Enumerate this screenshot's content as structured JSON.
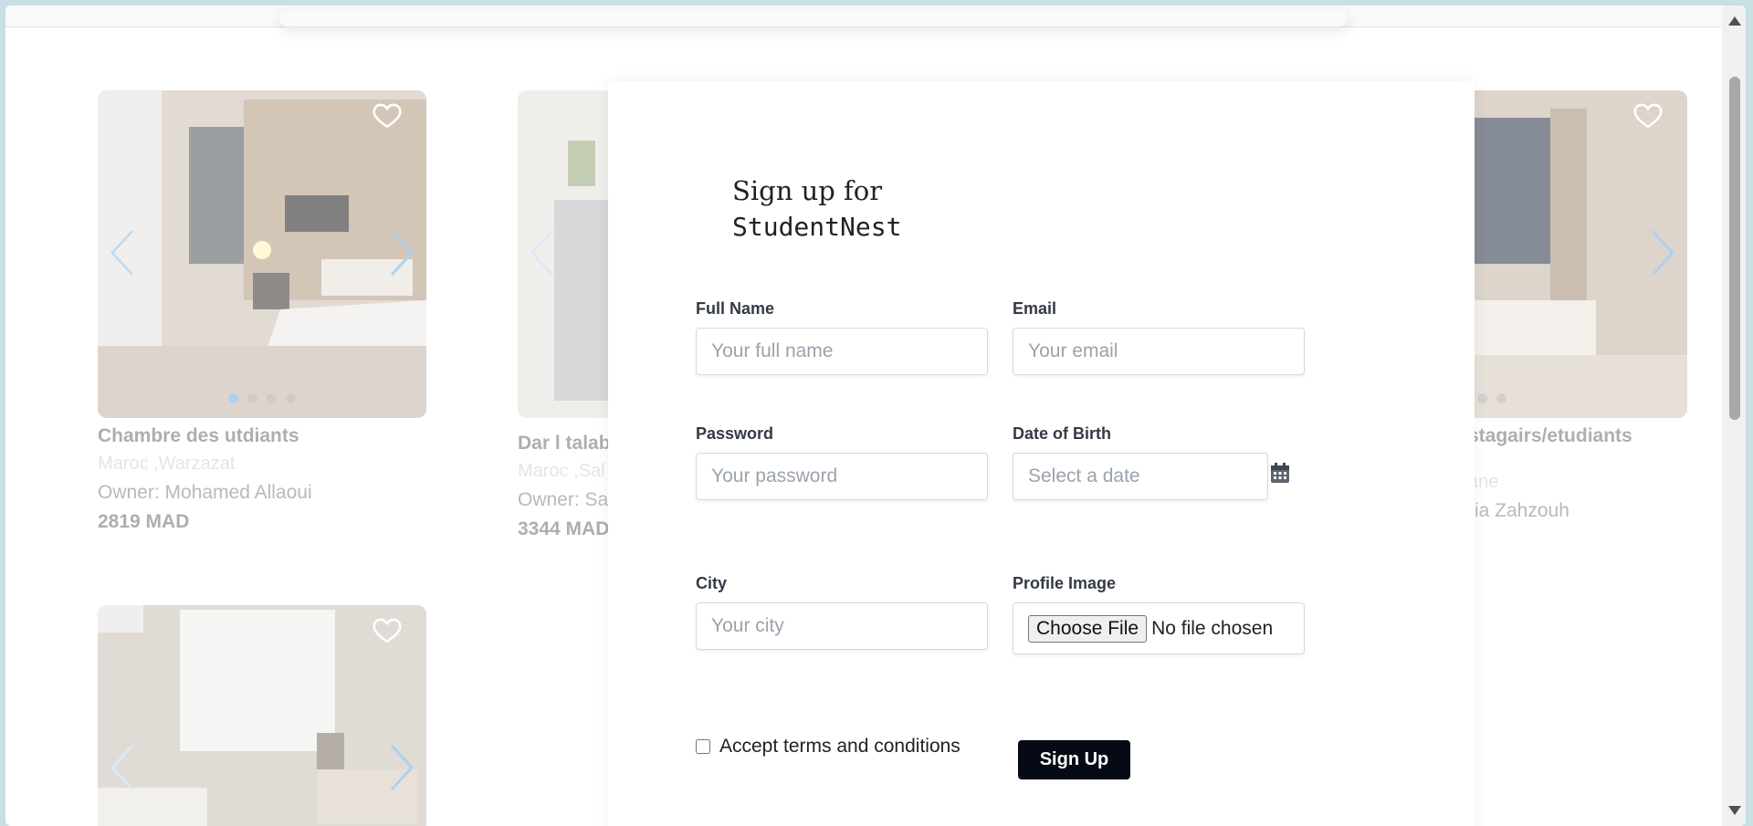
{
  "listings": [
    {
      "title": "Chambre des utdiants",
      "location": "Maroc ,Warzazat",
      "owner": "Owner: Mohamed Allaoui",
      "price": "2819 MAD",
      "dots": 4
    },
    {
      "title": "Dar l talab",
      "location": "Maroc ,Sal",
      "owner": "Owner: Saa",
      "price": "3344 MAD"
    },
    {
      "title": " stagairs/etudiants",
      "location": "ane",
      "owner": "ria Zahzouh",
      "price": "",
      "dots": 3
    },
    {
      "title": "",
      "location": "",
      "owner": "",
      "price": ""
    }
  ],
  "signup": {
    "title_line1": "Sign up for",
    "title_brand": "StudentNest",
    "full_name_label": "Full Name",
    "full_name_placeholder": "Your full name",
    "email_label": "Email",
    "email_placeholder": "Your email",
    "password_label": "Password",
    "password_placeholder": "Your password",
    "dob_label": "Date of Birth",
    "dob_placeholder": "Select a date",
    "city_label": "City",
    "city_placeholder": "Your city",
    "profile_image_label": "Profile Image",
    "file_button": "Choose File",
    "file_status": "No file chosen",
    "terms_label": "Accept terms and conditions",
    "submit_label": "Sign Up"
  },
  "colors": {
    "accent": "#7fb4e6",
    "button": "#050a14"
  }
}
